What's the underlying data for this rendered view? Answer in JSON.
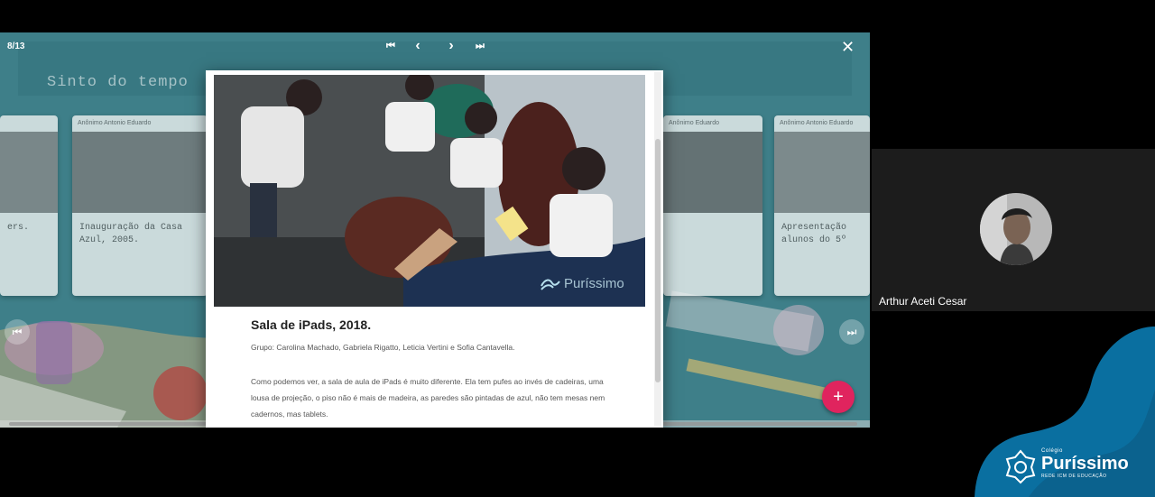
{
  "viewer": {
    "counter": "8/13",
    "close_label": "✕",
    "nav": {
      "first": "⏮",
      "prev": "‹",
      "next": "›",
      "last": "⏭"
    }
  },
  "wall": {
    "title": "Sinto do tempo",
    "cards": [
      {
        "header": "",
        "caption": "ers."
      },
      {
        "header": "Anônimo  Antonio Eduardo",
        "caption": "Inauguração da Casa\nAzul, 2005."
      },
      {
        "header": "Anônimo  Eduardo",
        "caption": ""
      },
      {
        "header": "Anônimo  Antonio Eduardo",
        "caption": "Apresentação\nalunos do 5º"
      }
    ],
    "prev_arrow": "⏮",
    "next_arrow": "⏭",
    "add_label": "+"
  },
  "post": {
    "title": "Sala de iPads, 2018.",
    "group": "Grupo: Carolina Machado, Gabriela Rigatto, Leticia Vertini e Sofia Cantavella.",
    "body": "Como podemos ver, a sala de aula de iPads é muito diferente. Ela tem pufes ao invés de cadeiras, uma lousa de projeção, o piso não é mais de madeira, as paredes são pintadas de azul, não tem mesas nem cadernos, mas tablets.",
    "watermark": "Puríssimo"
  },
  "participant": {
    "name": "Arthur Aceti Cesar"
  },
  "brand": {
    "small": "Colégio",
    "name": "Puríssimo",
    "sub": "REDE ICM DE EDUCAÇÃO"
  },
  "colors": {
    "teal": "#3e7f89",
    "brand_blue": "#0a6fa0",
    "fab": "#e0245e"
  }
}
